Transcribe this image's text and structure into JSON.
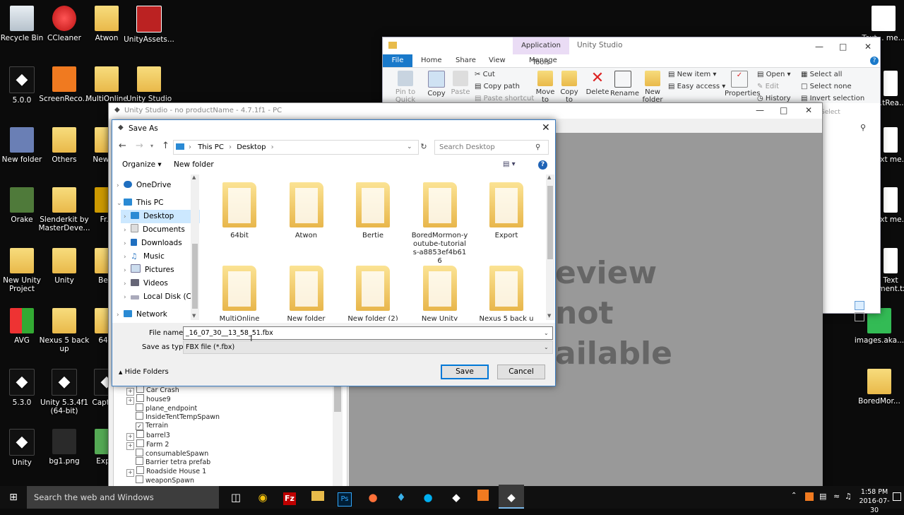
{
  "desktop": {
    "icons": [
      {
        "label": "Recycle Bin"
      },
      {
        "label": "CCleaner"
      },
      {
        "label": "Atwon"
      },
      {
        "label": "UnityAssets..."
      },
      {
        "label": "5.0.0"
      },
      {
        "label": "ScreenReco..."
      },
      {
        "label": "MultiOnline"
      },
      {
        "label": "Unity Studio"
      },
      {
        "label": "New folder"
      },
      {
        "label": "Others"
      },
      {
        "label": "New f..."
      },
      {
        "label": "Orake"
      },
      {
        "label": "Slenderkit by MasterDeve..."
      },
      {
        "label": "Fr..."
      },
      {
        "label": "New Unity Project"
      },
      {
        "label": "Unity"
      },
      {
        "label": "Be..."
      },
      {
        "label": "AVG"
      },
      {
        "label": "Nexus 5 back up"
      },
      {
        "label": "64..."
      },
      {
        "label": "5.3.0"
      },
      {
        "label": "Unity 5.3.4f1 (64-bit)"
      },
      {
        "label": "Captu..."
      },
      {
        "label": "Unity"
      },
      {
        "label": "bg1.png"
      },
      {
        "label": "Exp..."
      }
    ],
    "right_icons": [
      {
        "label": "Text... me..."
      },
      {
        "label": "...tRea..."
      },
      {
        "label": "Text me..."
      },
      {
        "label": "Text me..."
      },
      {
        "label": "Text ...ment.txt"
      },
      {
        "label": "images.aka..."
      },
      {
        "label": "BoredMor..."
      }
    ]
  },
  "explorer": {
    "title": "Unity Studio",
    "context_tab": "Application Tools",
    "tabs": [
      "File",
      "Home",
      "Share",
      "View",
      "Manage"
    ],
    "clipboard": {
      "pin": "Pin to Quick access",
      "copy": "Copy",
      "paste": "Paste",
      "cut": "Cut",
      "copy_path": "Copy path",
      "paste_shortcut": "Paste shortcut"
    },
    "organize": {
      "move": "Move to",
      "copy": "Copy to",
      "delete": "Delete",
      "rename": "Rename"
    },
    "new": {
      "new_folder": "New folder",
      "new_item": "New item",
      "easy_access": "Easy access"
    },
    "open": {
      "properties": "Properties",
      "open": "Open",
      "edit": "Edit",
      "history": "History"
    },
    "select": {
      "all": "Select all",
      "none": "Select none",
      "invert": "Invert selection",
      "label": "Select"
    }
  },
  "unity_studio": {
    "title": "Unity Studio - no productName - 4.7.1f1 - PC",
    "preview_text": [
      "eview",
      "not",
      "ailable"
    ],
    "hierarchy": [
      {
        "name": "Car Crash",
        "expand": true,
        "checked": false
      },
      {
        "name": "house9",
        "expand": true,
        "checked": false
      },
      {
        "name": "plane_endpoint",
        "expand": false,
        "checked": false
      },
      {
        "name": "InsideTentTempSpawn",
        "expand": false,
        "checked": false
      },
      {
        "name": "Terrain",
        "expand": false,
        "checked": true
      },
      {
        "name": "barrel3",
        "expand": true,
        "checked": false
      },
      {
        "name": "Farm 2",
        "expand": true,
        "checked": false
      },
      {
        "name": "consumableSpawn",
        "expand": false,
        "checked": false
      },
      {
        "name": "Barrier tetra prefab",
        "expand": false,
        "checked": false
      },
      {
        "name": "Roadside House 1",
        "expand": true,
        "checked": false
      },
      {
        "name": "weaponSpawn",
        "expand": false,
        "checked": false
      }
    ]
  },
  "save_dialog": {
    "title": "Save As",
    "breadcrumb": [
      "This PC",
      "Desktop"
    ],
    "search_placeholder": "Search Desktop",
    "organize": "Organize",
    "new_folder": "New folder",
    "nav": {
      "onedrive": "OneDrive",
      "this_pc": "This PC",
      "desktop": "Desktop",
      "documents": "Documents",
      "downloads": "Downloads",
      "music": "Music",
      "pictures": "Pictures",
      "videos": "Videos",
      "local_disk": "Local Disk (C:)",
      "network": "Network"
    },
    "files_row1": [
      {
        "name": "64bit"
      },
      {
        "name": "Atwon"
      },
      {
        "name": "Bertie"
      },
      {
        "name": "BoredMormon-youtube-tutorials-a8853ef4b616"
      },
      {
        "name": "Export"
      }
    ],
    "files_row2": [
      {
        "name": "MultiOnline"
      },
      {
        "name": "New folder"
      },
      {
        "name": "New folder (2)"
      },
      {
        "name": "New Unity"
      },
      {
        "name": "Nexus 5 back up"
      }
    ],
    "file_name_label": "File name:",
    "file_name_value": "_16_07_30__13_58_51.fbx",
    "save_type_label": "Save as type:",
    "save_type_value": "FBX file (*.fbx)",
    "hide_folders": "Hide Folders",
    "save": "Save",
    "cancel": "Cancel"
  },
  "taskbar": {
    "search_placeholder": "Search the web and Windows",
    "time": "1:58 PM",
    "date": "2016-07-30"
  }
}
